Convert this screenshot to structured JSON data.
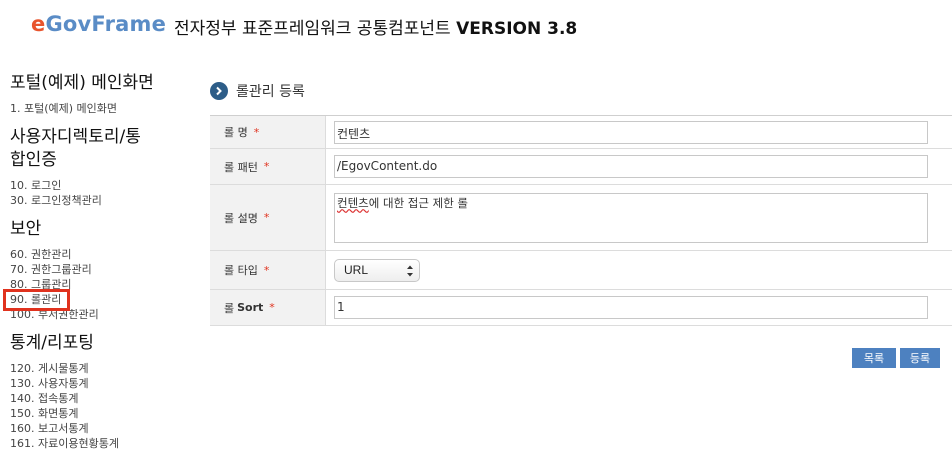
{
  "header": {
    "logo": {
      "e": "e",
      "gov": "Gov",
      "frame": "Frame"
    },
    "title": "전자정부 표준프레임워크 공통컴포넌트",
    "version": "VERSION 3.8"
  },
  "sidebar": {
    "sections": [
      {
        "title": "포털(예제) 메인화면",
        "items": [
          "1. 포털(예제) 메인화면"
        ]
      },
      {
        "title_line1": "사용자디렉토리/통",
        "title_line2": "합인증",
        "items": [
          "10. 로그인",
          "30. 로그인정책관리"
        ]
      },
      {
        "title": "보안",
        "items": [
          "60. 권한관리",
          "70. 권한그룹관리",
          "80. 그룹관리",
          "90. 롤관리",
          "100. 부서권한관리"
        ]
      },
      {
        "title": "통계/리포팅",
        "items": [
          "120. 게시물통계",
          "130. 사용자통계",
          "140. 접속통계",
          "150. 화면통계",
          "160. 보고서통계",
          "161. 자료이용현황통계"
        ]
      }
    ]
  },
  "main": {
    "title": "롤관리 등록",
    "form": {
      "role_name": {
        "label": "롤 명",
        "value": "컨텐츠"
      },
      "role_pattern": {
        "label": "롤 패턴",
        "value": "/EgovContent.do"
      },
      "role_desc": {
        "label": "롤 설명",
        "value_word1": "컨텐츠",
        "value_rest": "에 대한 접근 제한 롤"
      },
      "role_type": {
        "label": "롤 타입",
        "value": "URL"
      },
      "role_sort": {
        "label_prefix": "롤",
        "label_bold": "Sort",
        "value": "1"
      },
      "required_mark": "*"
    },
    "buttons": {
      "list": "목록",
      "register": "등록"
    }
  },
  "colors": {
    "accent": "#4d81c0",
    "highlight": "#e0321e",
    "required": "#e0321e",
    "title_circle": "#2d5d88"
  }
}
